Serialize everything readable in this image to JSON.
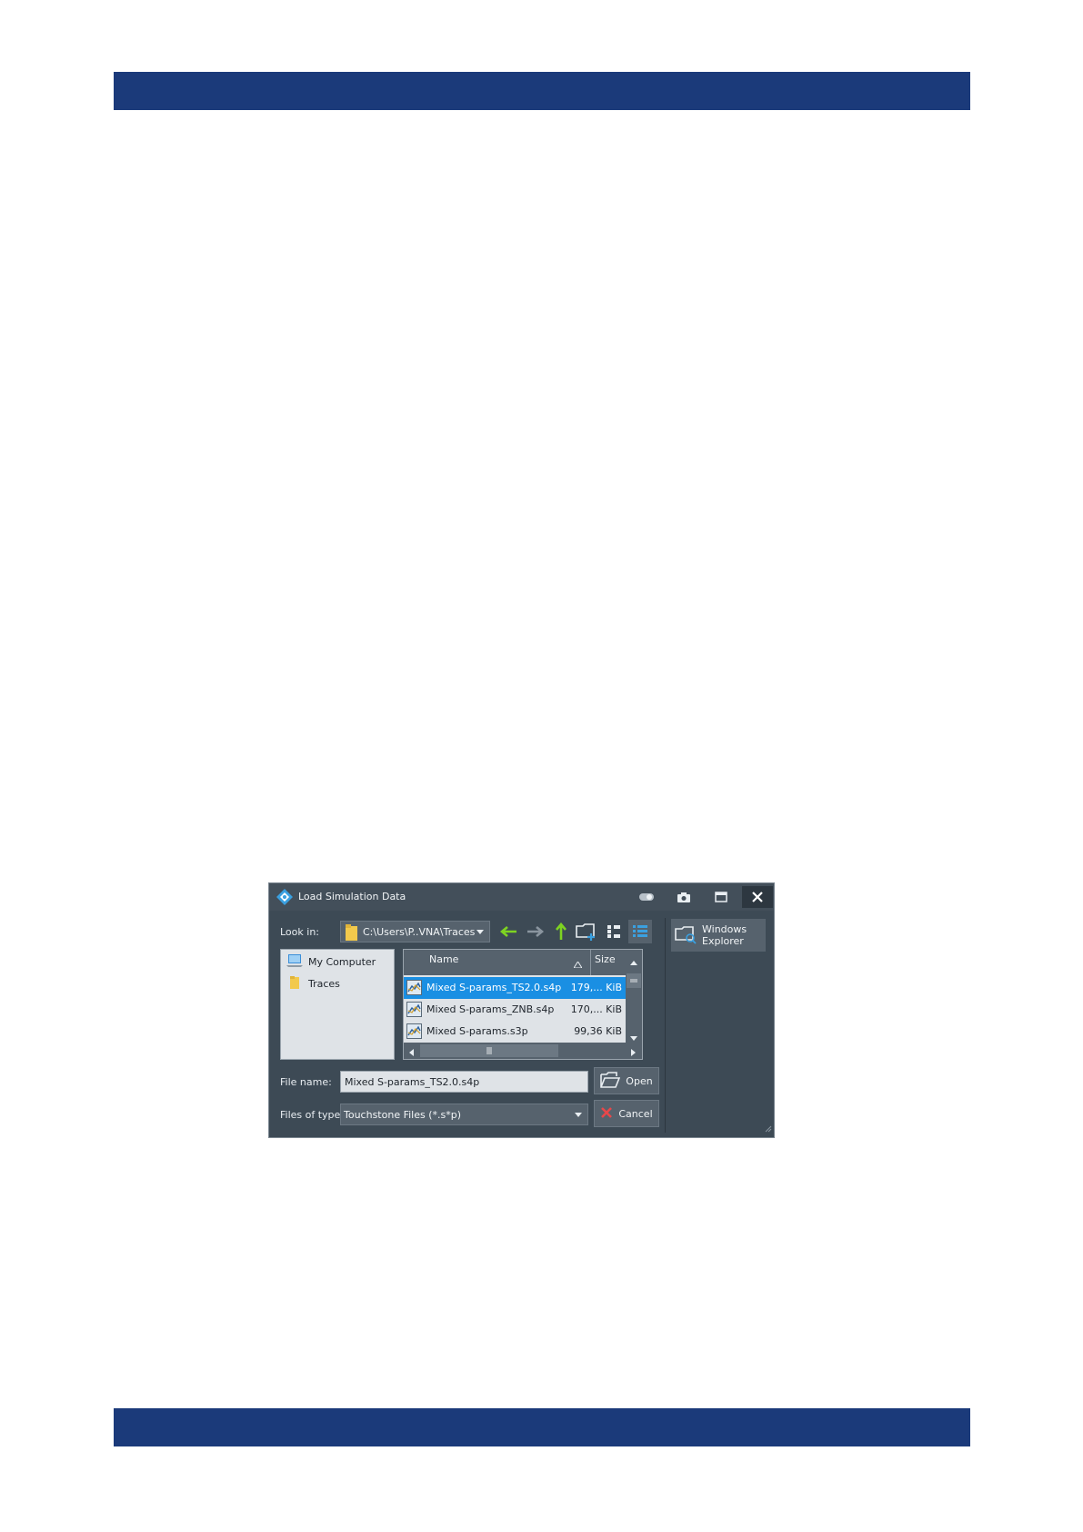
{
  "dialog": {
    "title": "Load Simulation Data",
    "look_in_label": "Look in:",
    "path": "C:\\Users\\P..VNA\\Traces",
    "tree": [
      {
        "label": "My Computer",
        "icon": "computer-icon"
      },
      {
        "label": "Traces",
        "icon": "folder-icon"
      }
    ],
    "columns": {
      "name": "Name",
      "size": "Size"
    },
    "files": [
      {
        "name": "Mixed S-params_TS2.0.s4p",
        "size": "179,... KiB",
        "selected": true
      },
      {
        "name": "Mixed S-params_ZNB.s4p",
        "size": "170,... KiB",
        "selected": false
      },
      {
        "name": "Mixed S-params.s3p",
        "size": "99,36 KiB",
        "selected": false
      }
    ],
    "file_name_label": "File name:",
    "file_name_value": "Mixed S-params_TS2.0.s4p",
    "file_type_label": "Files of type:",
    "file_type_value": "Touchstone Files (*.s*p)",
    "open_label": "Open",
    "cancel_label": "Cancel",
    "explorer_label_1": "Windows",
    "explorer_label_2": "Explorer"
  },
  "colors": {
    "page_band": "#1b3a7a",
    "dialog_bg": "#3d4a55",
    "selection": "#1a8fe3",
    "nav_arrow_green": "#7ed321"
  }
}
